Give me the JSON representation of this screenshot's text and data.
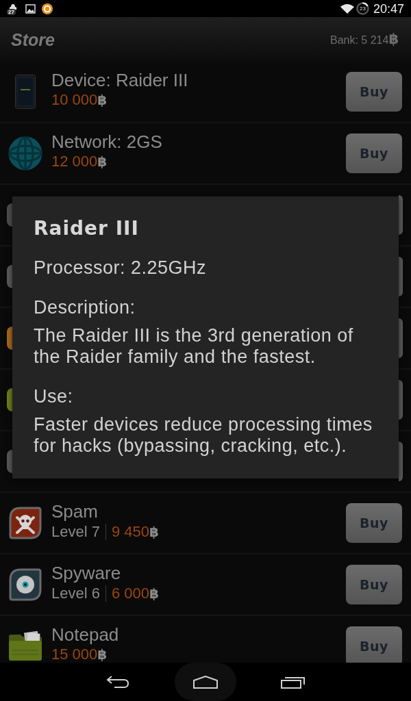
{
  "status_bar": {
    "notification_badge": "27",
    "ring_indicator": "23",
    "time": "20:47"
  },
  "header": {
    "title": "Store",
    "bank": "Bank: 5 214",
    "currency": "฿"
  },
  "items": [
    {
      "kind": "device",
      "title": "Device: Raider III",
      "price": "10 000",
      "currency": "฿",
      "button": "Buy"
    },
    {
      "kind": "network",
      "title": "Network: 2GS",
      "price": "12 000",
      "currency": "฿",
      "button": "Buy"
    },
    {
      "kind": "covered",
      "color": "#4e4e4e"
    },
    {
      "kind": "covered",
      "color": "#5a5a5a"
    },
    {
      "kind": "covered",
      "color": "#a4681c"
    },
    {
      "kind": "covered",
      "color": "#6e7c1c"
    },
    {
      "kind": "covered",
      "color": "#585858"
    },
    {
      "kind": "spam",
      "title": "Spam",
      "level": "Level 7",
      "price": "9 450",
      "currency": "฿",
      "button": "Buy"
    },
    {
      "kind": "spyware",
      "title": "Spyware",
      "level": "Level 6",
      "price": "6 000",
      "currency": "฿",
      "button": "Buy"
    },
    {
      "kind": "notepad",
      "title": "Notepad",
      "price": "15 000",
      "currency": "฿",
      "button": "Buy"
    }
  ],
  "dialog": {
    "title": "Raider III",
    "spec": "Processor: 2.25GHz",
    "sections": [
      {
        "heading": "Description:",
        "text": "The Raider III is the 3rd generation of the Raider family and the fastest."
      },
      {
        "heading": "Use:",
        "text": "Faster devices reduce processing times for hacks (bypassing, cracking, etc.)."
      }
    ]
  }
}
